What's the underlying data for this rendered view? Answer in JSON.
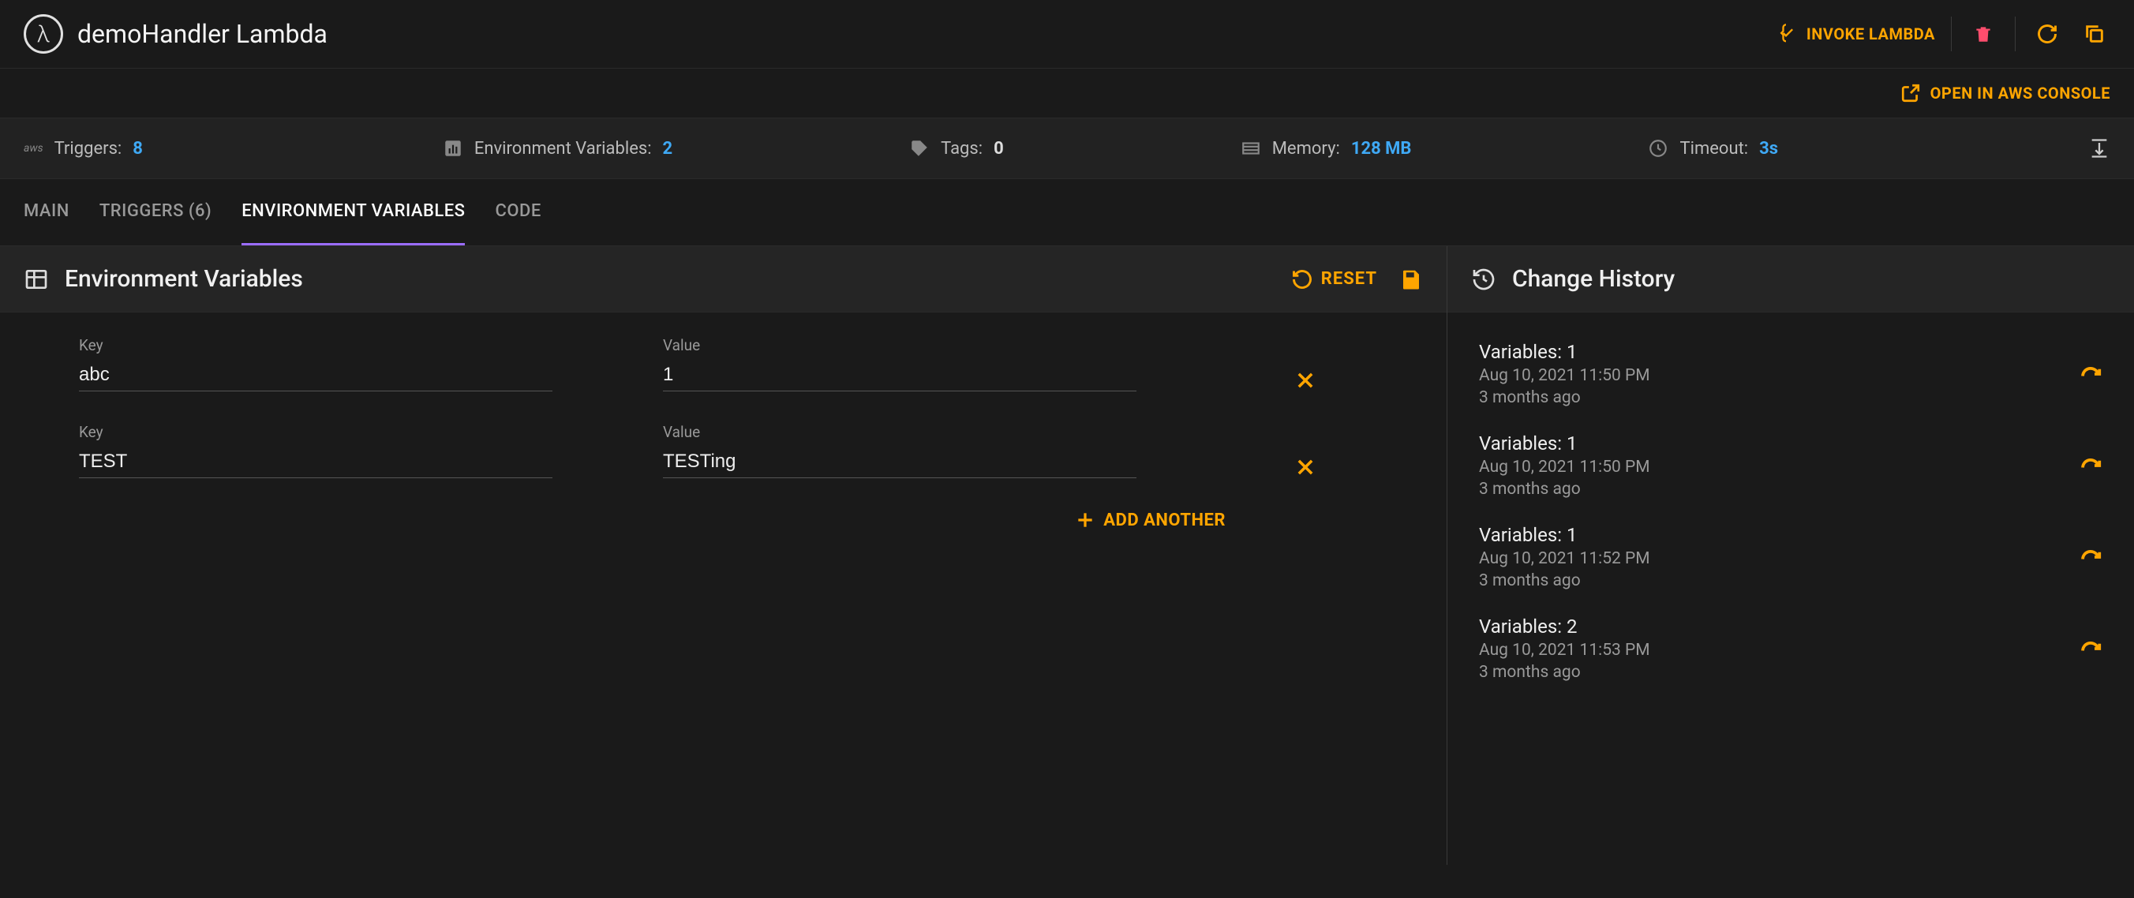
{
  "header": {
    "title": "demoHandler Lambda",
    "invoke_label": "INVOKE LAMBDA",
    "open_aws_label": "OPEN IN AWS CONSOLE"
  },
  "stats": {
    "triggers_label": "Triggers:",
    "triggers_value": "8",
    "envvars_label": "Environment Variables:",
    "envvars_value": "2",
    "tags_label": "Tags:",
    "tags_value": "0",
    "memory_label": "Memory:",
    "memory_value": "128 MB",
    "timeout_label": "Timeout:",
    "timeout_value": "3s"
  },
  "tabs": {
    "main": "MAIN",
    "triggers": "TRIGGERS (6)",
    "envvars": "ENVIRONMENT VARIABLES",
    "code": "CODE"
  },
  "panel": {
    "title": "Environment Variables",
    "reset_label": "RESET",
    "key_label": "Key",
    "value_label": "Value",
    "add_label": "ADD ANOTHER"
  },
  "env_rows": [
    {
      "key": "abc",
      "value": "1"
    },
    {
      "key": "TEST",
      "value": "TESTing"
    }
  ],
  "history": {
    "title": "Change History",
    "items": [
      {
        "title": "Variables: 1",
        "date": "Aug 10, 2021 11:50 PM",
        "ago": "3 months ago"
      },
      {
        "title": "Variables: 1",
        "date": "Aug 10, 2021 11:50 PM",
        "ago": "3 months ago"
      },
      {
        "title": "Variables: 1",
        "date": "Aug 10, 2021 11:52 PM",
        "ago": "3 months ago"
      },
      {
        "title": "Variables: 2",
        "date": "Aug 10, 2021 11:53 PM",
        "ago": "3 months ago"
      }
    ]
  }
}
